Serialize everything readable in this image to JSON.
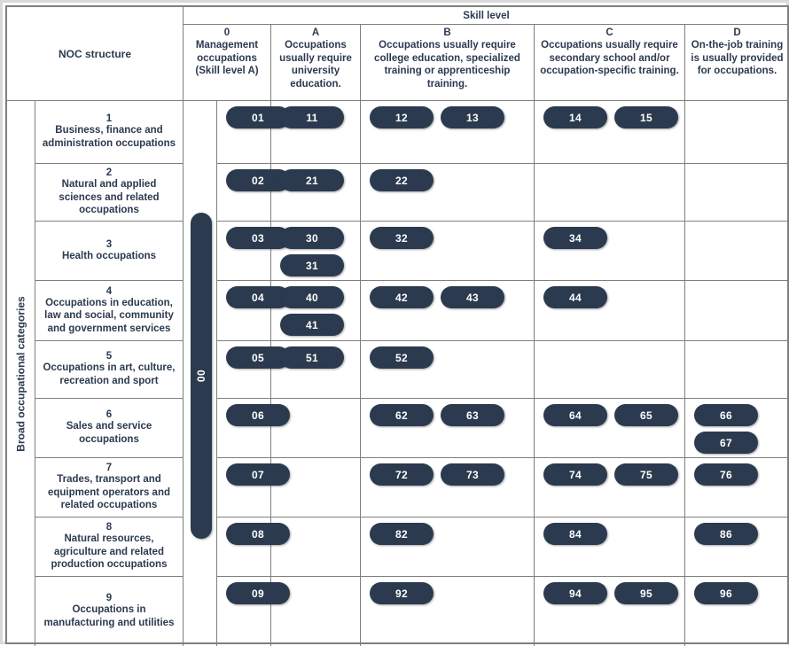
{
  "chart_data": {
    "type": "table",
    "title": "NOC structure",
    "xlabel": "Skill level",
    "ylabel": "Broad occupational categories",
    "categories": [
      "1 Business, finance and administration occupations",
      "2 Natural and applied sciences and related occupations",
      "3 Health occupations",
      "4 Occupations in education, law and social, community and government services",
      "5 Occupations in art, culture, recreation and sport",
      "6 Sales and service occupations",
      "7 Trades, transport and equipment operators and related occupations",
      "8 Natural resources, agriculture and related production occupations",
      "9 Occupations in manufacturing and utilities"
    ],
    "columns": [
      "0",
      "A",
      "B",
      "C",
      "D"
    ],
    "cells": [
      [
        [
          "01"
        ],
        [
          "11"
        ],
        [
          "12",
          "13"
        ],
        [
          "14",
          "15"
        ],
        []
      ],
      [
        [
          "02"
        ],
        [
          "21"
        ],
        [
          "22"
        ],
        [],
        []
      ],
      [
        [
          "03"
        ],
        [
          "30",
          "31"
        ],
        [
          "32"
        ],
        [
          "34"
        ],
        []
      ],
      [
        [
          "04"
        ],
        [
          "40",
          "41"
        ],
        [
          "42",
          "43"
        ],
        [
          "44"
        ],
        []
      ],
      [
        [
          "05"
        ],
        [
          "51"
        ],
        [
          "52"
        ],
        [],
        []
      ],
      [
        [
          "06"
        ],
        [],
        [
          "62",
          "63"
        ],
        [
          "64",
          "65"
        ],
        [
          "66",
          "67"
        ]
      ],
      [
        [
          "07"
        ],
        [],
        [
          "72",
          "73"
        ],
        [
          "74",
          "75"
        ],
        [
          "76"
        ]
      ],
      [
        [
          "08"
        ],
        [],
        [
          "82"
        ],
        [
          "84"
        ],
        [
          "86"
        ]
      ],
      [
        [
          "09"
        ],
        [],
        [
          "92"
        ],
        [
          "94",
          "95"
        ],
        [
          "96"
        ]
      ]
    ],
    "management_badge": "00"
  },
  "header": {
    "row_header_title": "NOC structure",
    "skill_level_banner": "Skill level",
    "corner_spine_label": "Broad occupational categories"
  },
  "skill_columns": [
    {
      "code": "0",
      "desc": "Management occupations (Skill level A)"
    },
    {
      "code": "A",
      "desc": "Occupations usually require university education."
    },
    {
      "code": "B",
      "desc": "Occupations usually require college education, specialized training or apprenticeship training."
    },
    {
      "code": "C",
      "desc": "Occupations usually require secondary school and/or occupation-specific training."
    },
    {
      "code": "D",
      "desc": "On-the-job training is usually provided for occupations."
    }
  ],
  "rows": [
    {
      "num": "1",
      "name": "Business, finance and administration occupations"
    },
    {
      "num": "2",
      "name": "Natural and applied sciences and related occupations"
    },
    {
      "num": "3",
      "name": "Health occupations"
    },
    {
      "num": "4",
      "name": "Occupations in education, law and social, community and government services"
    },
    {
      "num": "5",
      "name": "Occupations in art, culture, recreation and sport"
    },
    {
      "num": "6",
      "name": "Sales and service occupations"
    },
    {
      "num": "7",
      "name": "Trades, transport and equipment operators and related occupations"
    },
    {
      "num": "8",
      "name": "Natural resources, agriculture and related production occupations"
    },
    {
      "num": "9",
      "name": "Occupations in manufacturing and utilities"
    }
  ],
  "management_badge": "00",
  "badges": {
    "r1": {
      "c0": [
        "01"
      ],
      "cA": [
        "11"
      ],
      "cB": [
        "12",
        "13"
      ],
      "cC": [
        "14",
        "15"
      ],
      "cD": []
    },
    "r2": {
      "c0": [
        "02"
      ],
      "cA": [
        "21"
      ],
      "cB": [
        "22"
      ],
      "cC": [],
      "cD": []
    },
    "r3": {
      "c0": [
        "03"
      ],
      "cA": [
        "30",
        "31"
      ],
      "cB": [
        "32"
      ],
      "cC": [
        "34"
      ],
      "cD": []
    },
    "r4": {
      "c0": [
        "04"
      ],
      "cA": [
        "40",
        "41"
      ],
      "cB": [
        "42",
        "43"
      ],
      "cC": [
        "44"
      ],
      "cD": []
    },
    "r5": {
      "c0": [
        "05"
      ],
      "cA": [
        "51"
      ],
      "cB": [
        "52"
      ],
      "cC": [],
      "cD": []
    },
    "r6": {
      "c0": [
        "06"
      ],
      "cA": [],
      "cB": [
        "62",
        "63"
      ],
      "cC": [
        "64",
        "65"
      ],
      "cD": [
        "66",
        "67"
      ]
    },
    "r7": {
      "c0": [
        "07"
      ],
      "cA": [],
      "cB": [
        "72",
        "73"
      ],
      "cC": [
        "74",
        "75"
      ],
      "cD": [
        "76"
      ]
    },
    "r8": {
      "c0": [
        "08"
      ],
      "cA": [],
      "cB": [
        "82"
      ],
      "cC": [
        "84"
      ],
      "cD": [
        "86"
      ]
    },
    "r9": {
      "c0": [
        "09"
      ],
      "cA": [],
      "cB": [
        "92"
      ],
      "cC": [
        "94",
        "95"
      ],
      "cD": [
        "96"
      ]
    }
  },
  "colors": {
    "badge_fill": "#2b3a4f",
    "badge_text": "#ffffff",
    "grid_line": "#7f7f7f",
    "outer_frame": "#d9d9d9",
    "text": "#2b3a4f",
    "background": "#ffffff"
  }
}
